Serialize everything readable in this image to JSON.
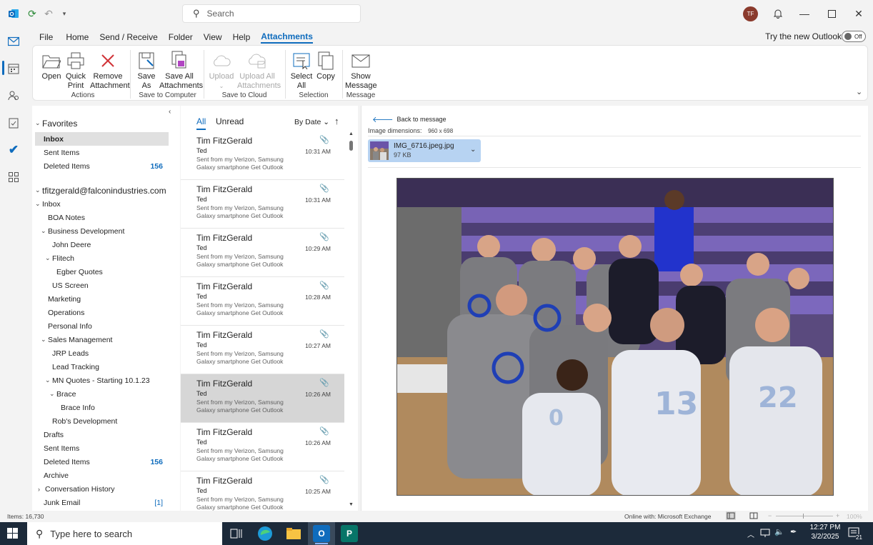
{
  "titlebar": {
    "search_placeholder": "Search",
    "avatar_initials": "TF"
  },
  "menu": {
    "items": [
      "File",
      "Home",
      "Send / Receive",
      "Folder",
      "View",
      "Help",
      "Attachments"
    ],
    "active": "Attachments",
    "try_new": "Try the new Outlook",
    "toggle_label": "Off"
  },
  "ribbon": {
    "open": "Open",
    "quick_print_1": "Quick",
    "quick_print_2": "Print",
    "remove_1": "Remove",
    "remove_2": "Attachment",
    "save_as_1": "Save",
    "save_as_2": "As",
    "save_all_1": "Save All",
    "save_all_2": "Attachments",
    "upload": "Upload",
    "upload_all_1": "Upload All",
    "upload_all_2": "Attachments",
    "select_all_1": "Select",
    "select_all_2": "All",
    "copy": "Copy",
    "show_msg_1": "Show",
    "show_msg_2": "Message",
    "groups": {
      "actions": "Actions",
      "save_computer": "Save to Computer",
      "save_cloud": "Save to Cloud",
      "selection": "Selection",
      "message": "Message"
    }
  },
  "folders": {
    "favorites_header": "Favorites",
    "favorites": [
      {
        "label": "Inbox",
        "count": ""
      },
      {
        "label": "Sent Items",
        "count": ""
      },
      {
        "label": "Deleted Items",
        "count": "156"
      }
    ],
    "account": "tfitzgerald@falconindustries.com",
    "tree": [
      {
        "label": "Inbox",
        "count": ""
      },
      {
        "label": "BOA Notes",
        "count": ""
      },
      {
        "label": "Business Development",
        "count": ""
      },
      {
        "label": "John Deere",
        "count": ""
      },
      {
        "label": "Flitech",
        "count": ""
      },
      {
        "label": "Egber Quotes",
        "count": ""
      },
      {
        "label": "US Screen",
        "count": ""
      },
      {
        "label": "Marketing",
        "count": ""
      },
      {
        "label": "Operations",
        "count": ""
      },
      {
        "label": "Personal Info",
        "count": ""
      },
      {
        "label": "Sales Management",
        "count": ""
      },
      {
        "label": "JRP Leads",
        "count": ""
      },
      {
        "label": "Lead Tracking",
        "count": ""
      },
      {
        "label": "MN Quotes - Starting 10.1.23",
        "count": ""
      },
      {
        "label": "Brace",
        "count": ""
      },
      {
        "label": "Brace Info",
        "count": ""
      },
      {
        "label": "Rob's Development",
        "count": ""
      },
      {
        "label": "Drafts",
        "count": ""
      },
      {
        "label": "Sent Items",
        "count": ""
      },
      {
        "label": "Deleted Items",
        "count": "156"
      },
      {
        "label": "Archive",
        "count": ""
      },
      {
        "label": "Conversation History",
        "count": ""
      },
      {
        "label": "Junk Email",
        "count": "[1]"
      }
    ]
  },
  "messagelist": {
    "tab_all": "All",
    "tab_unread": "Unread",
    "sort": "By Date",
    "messages": [
      {
        "from": "Tim FitzGerald",
        "subject": "Ted",
        "preview": "Sent from my Verizon, Samsung Galaxy smartphone Get Outlook",
        "time": "10:31 AM"
      },
      {
        "from": "Tim FitzGerald",
        "subject": "Ted",
        "preview": "Sent from my Verizon, Samsung Galaxy smartphone Get Outlook",
        "time": "10:31 AM"
      },
      {
        "from": "Tim FitzGerald",
        "subject": "Ted",
        "preview": "Sent from my Verizon, Samsung Galaxy smartphone Get Outlook",
        "time": "10:29 AM"
      },
      {
        "from": "Tim FitzGerald",
        "subject": "Ted",
        "preview": "Sent from my Verizon, Samsung Galaxy smartphone Get Outlook",
        "time": "10:28 AM"
      },
      {
        "from": "Tim FitzGerald",
        "subject": "Ted",
        "preview": "Sent from my Verizon, Samsung Galaxy smartphone Get Outlook",
        "time": "10:27 AM"
      },
      {
        "from": "Tim FitzGerald",
        "subject": "Ted",
        "preview": "Sent from my Verizon, Samsung Galaxy smartphone Get Outlook",
        "time": "10:26 AM"
      },
      {
        "from": "Tim FitzGerald",
        "subject": "Ted",
        "preview": "Sent from my Verizon, Samsung Galaxy smartphone Get Outlook",
        "time": "10:26 AM"
      },
      {
        "from": "Tim FitzGerald",
        "subject": "Ted",
        "preview": "Sent from my Verizon, Samsung Galaxy smartphone Get Outlook",
        "time": "10:25 AM"
      }
    ]
  },
  "reading": {
    "back": "Back to message",
    "dimensions_label": "Image dimensions:",
    "dimensions_value": "960 x 698",
    "file_name": "IMG_6716.jpeg.jpg",
    "file_size": "97 KB",
    "jersey_1": "13",
    "jersey_2": "22",
    "jersey_3": "0"
  },
  "status": {
    "items": "Items: 16,730",
    "connection": "Online with: Microsoft Exchange",
    "zoom": "100%"
  },
  "taskbar": {
    "search": "Type here to search",
    "time": "12:27 PM",
    "date": "3/2/2025",
    "notif": "21"
  }
}
